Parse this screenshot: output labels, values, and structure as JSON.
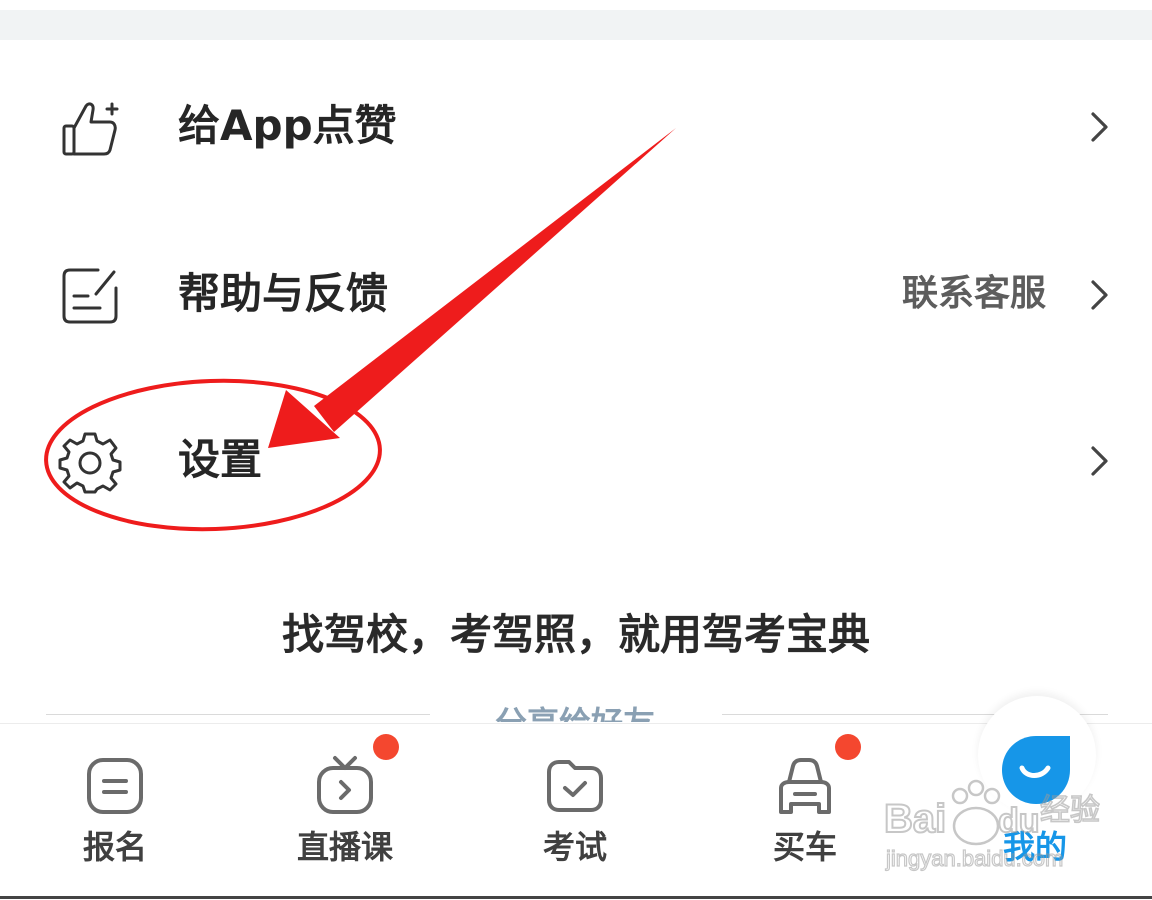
{
  "menu": [
    {
      "id": "rate",
      "label": "给App点赞",
      "extra": "",
      "icon": "thumbs-up-plus-icon"
    },
    {
      "id": "help",
      "label": "帮助与反馈",
      "extra": "联系客服",
      "icon": "feedback-edit-icon"
    },
    {
      "id": "settings",
      "label": "设置",
      "extra": "",
      "icon": "gear-icon"
    }
  ],
  "slogan": "找驾校，考驾照，就用驾考宝典",
  "share_label": "分享给好友",
  "tabs": [
    {
      "label": "报名",
      "icon": "signup-icon",
      "badge": false
    },
    {
      "label": "直播课",
      "icon": "live-tv-icon",
      "badge": true
    },
    {
      "label": "考试",
      "icon": "exam-folder-icon",
      "badge": false
    },
    {
      "label": "买车",
      "icon": "car-icon",
      "badge": true
    },
    {
      "label": "我的",
      "icon": "smile-drop-icon",
      "badge": false,
      "active": true
    }
  ],
  "watermark": {
    "brand": "Bai du 经验",
    "url": "jingyan.baidu.com"
  },
  "colors": {
    "accent": "#1696e8",
    "badge": "#f4472f",
    "annotation": "#ee1c1c"
  }
}
